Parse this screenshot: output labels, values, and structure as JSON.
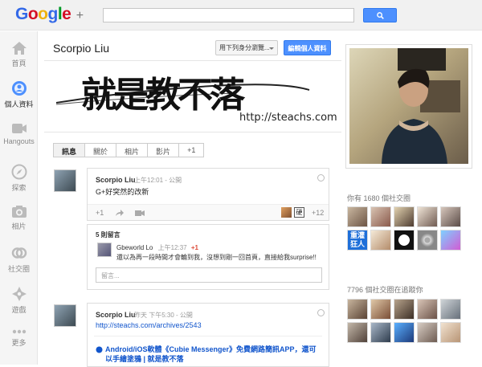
{
  "header": {
    "logo_text": "Google",
    "logo_plus": "+",
    "search_placeholder": ""
  },
  "nav": {
    "items": [
      {
        "label": "首頁",
        "icon": "home-icon"
      },
      {
        "label": "個人資料",
        "icon": "profile-icon",
        "active": true
      },
      {
        "label": "Hangouts",
        "icon": "hangouts-icon"
      },
      {
        "label": "探索",
        "icon": "explore-icon"
      },
      {
        "label": "相片",
        "icon": "photos-icon"
      },
      {
        "label": "社交圈",
        "icon": "circles-icon"
      },
      {
        "label": "遊戲",
        "icon": "games-icon"
      },
      {
        "label": "更多",
        "icon": "more-icon"
      }
    ]
  },
  "profile": {
    "name": "Scorpio Liu",
    "view_as_label": "用下列身分瀏覽...",
    "edit_button": "編輯個人資料",
    "banner_text": "就是教不落",
    "banner_url": "http://steachs.com"
  },
  "tabs": [
    "訊息",
    "關於",
    "相片",
    "影片",
    "+1"
  ],
  "posts": [
    {
      "author": "Scorpio Liu",
      "time": "上午12:01 - 公開",
      "body": "G+好突然的改新",
      "plus_one": "+1",
      "plus_count": "+12",
      "comment_count": "5 則留言",
      "comment": {
        "author": "Gbeworld Lo",
        "time": "上午12:37",
        "plus": "+1",
        "text": "還以為再一段時間才會輪到我，沒想到剛一回首頁，直接給我surprise!!"
      },
      "comment_placeholder": "留言..."
    },
    {
      "author": "Scorpio Liu",
      "time": "昨天 下午5:30 - 公開",
      "link": "http://steachs.com/archives/2543",
      "title": "Android/iOS軟體《Cubie Messenger》免費網路簡訊APP，還可以手繪塗鴉 | 就是教不落"
    }
  ],
  "sidebar": {
    "in_circles": "你有 1680 個社交圈",
    "followers": "7796 個社交圈在追蹤你",
    "badge_chinese": "重灌狂人"
  },
  "colors": {
    "accent": "#4d90fe",
    "link": "#1155cc",
    "plus_red": "#dd4b39"
  }
}
